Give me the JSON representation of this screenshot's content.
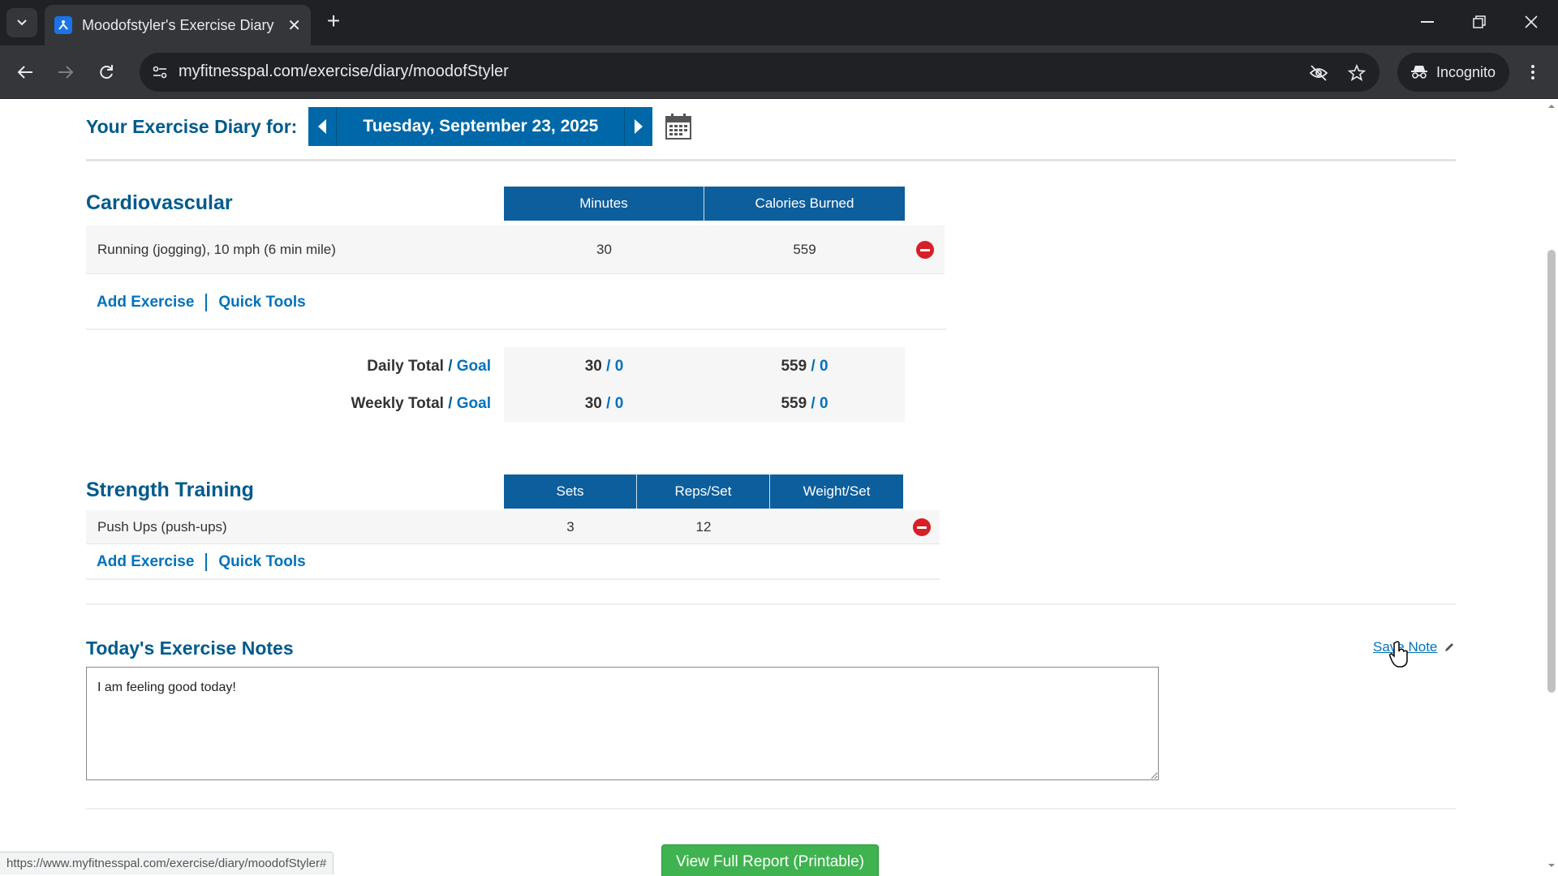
{
  "browser": {
    "tab_title": "Moodofstyler's Exercise Diary |",
    "url": "myfitnesspal.com/exercise/diary/moodofStyler",
    "incognito_label": "Incognito",
    "status_url": "https://www.myfitnesspal.com/exercise/diary/moodofStyler#"
  },
  "header": {
    "label": "Your Exercise Diary for:",
    "date": "Tuesday, September 23, 2025"
  },
  "cardio": {
    "title": "Cardiovascular",
    "columns": [
      "Minutes",
      "Calories Burned"
    ],
    "entries": [
      {
        "name": "Running (jogging), 10 mph (6 min mile)",
        "minutes": "30",
        "calories": "559"
      }
    ],
    "add_exercise": "Add Exercise",
    "quick_tools": "Quick Tools",
    "daily_total_label": "Daily Total",
    "weekly_total_label": "Weekly Total",
    "goal_label": "Goal",
    "slash": " / ",
    "daily": {
      "minutes": "30",
      "minutes_goal": "0",
      "calories": "559",
      "calories_goal": "0"
    },
    "weekly": {
      "minutes": "30",
      "minutes_goal": "0",
      "calories": "559",
      "calories_goal": "0"
    }
  },
  "strength": {
    "title": "Strength Training",
    "columns": [
      "Sets",
      "Reps/Set",
      "Weight/Set"
    ],
    "entries": [
      {
        "name": "Push Ups (push-ups)",
        "sets": "3",
        "reps": "12",
        "weight": ""
      }
    ],
    "add_exercise": "Add Exercise",
    "quick_tools": "Quick Tools"
  },
  "notes": {
    "title": "Today's Exercise Notes",
    "save_label": "Save Note",
    "text": "I am feeling good today!"
  },
  "report_button": "View Full Report (Printable)",
  "colors": {
    "header_blue": "#0d5e9c",
    "title_blue": "#005a8c",
    "link_blue": "#0072bc",
    "remove_red": "#d61f26",
    "report_green": "#3fb34f"
  }
}
